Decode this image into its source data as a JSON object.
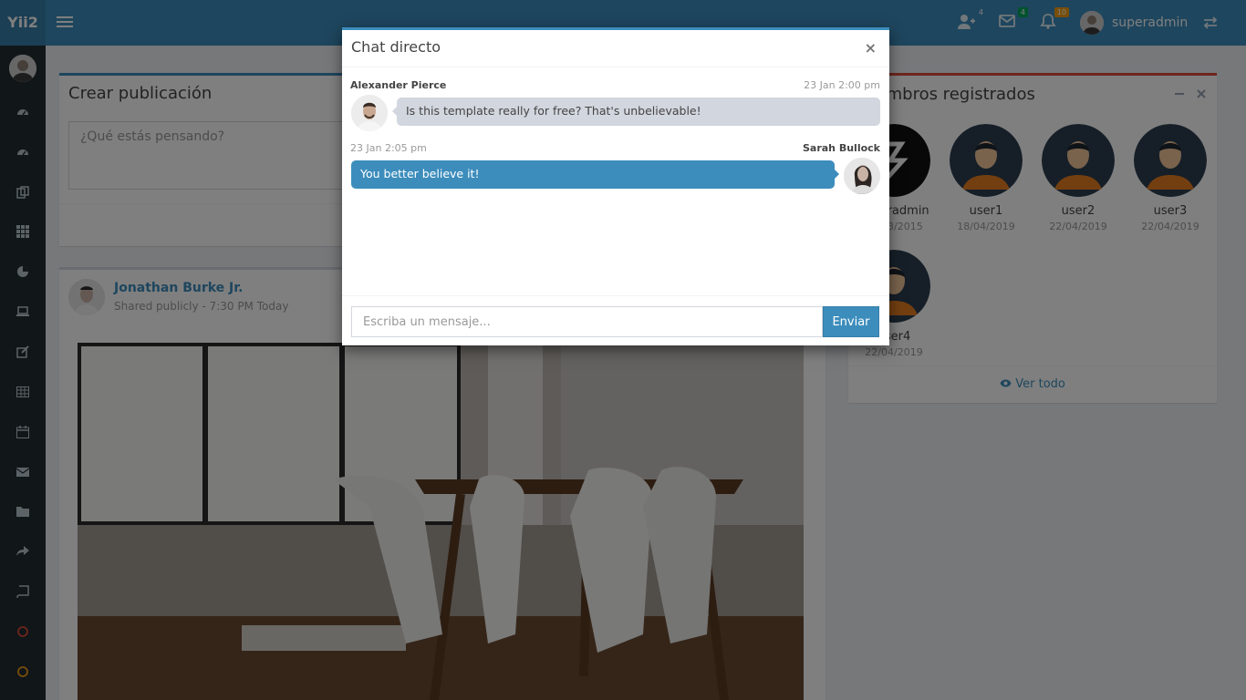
{
  "header": {
    "logo": "Yii2",
    "user_name": "superadmin",
    "badges": {
      "users": "4",
      "messages": "4",
      "notifications": "10"
    }
  },
  "colors": {
    "primary": "#3c8dbc",
    "sidebar": "#222d32",
    "badge_blue": "#3c8dbc",
    "badge_green": "#00a65a",
    "badge_orange": "#f39c12",
    "danger": "#dd4b39"
  },
  "post": {
    "title": "Crear publicación",
    "placeholder": "¿Qué estás pensando?"
  },
  "feed": {
    "author": "Jonathan Burke Jr.",
    "meta": "Shared publicly - 7:30 PM Today"
  },
  "members": {
    "title": "Miembros registrados",
    "view_all": "Ver todo",
    "list": [
      {
        "name": "superadmin",
        "date": "10/03/2015"
      },
      {
        "name": "user1",
        "date": "18/04/2019"
      },
      {
        "name": "user2",
        "date": "22/04/2019"
      },
      {
        "name": "user3",
        "date": "22/04/2019"
      },
      {
        "name": "user4",
        "date": "22/04/2019"
      }
    ]
  },
  "chat": {
    "title": "Chat directo",
    "close": "×",
    "messages": [
      {
        "name": "Alexander Pierce",
        "time": "23 Jan 2:00 pm",
        "text": "Is this template really for free? That's unbelievable!"
      },
      {
        "name": "Sarah Bullock",
        "time": "23 Jan 2:05 pm",
        "text": "You better believe it!"
      }
    ],
    "input_placeholder": "Escriba un mensaje...",
    "send_label": "Enviar"
  }
}
